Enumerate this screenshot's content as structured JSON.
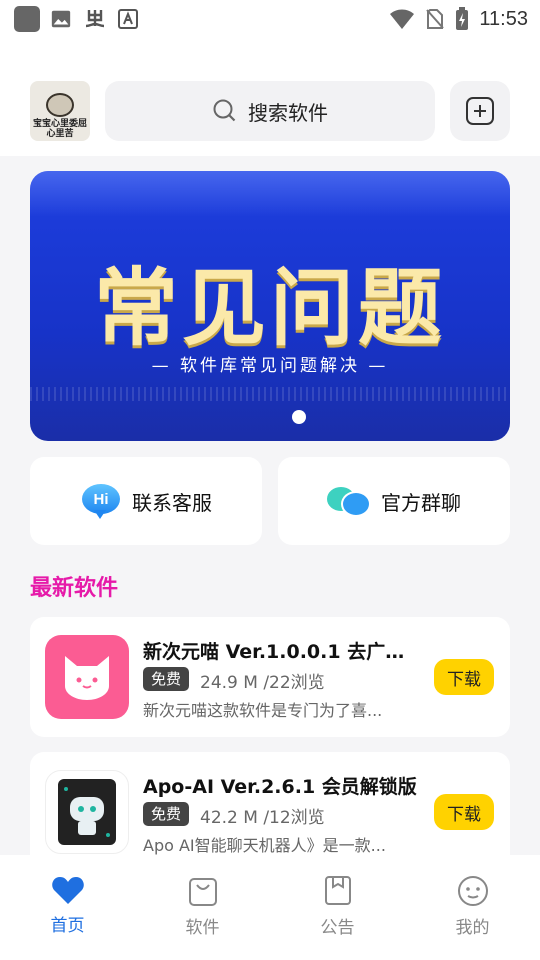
{
  "status_bar": {
    "time": "11:53"
  },
  "header": {
    "avatar_caption": "宝宝心里委屈心里苦",
    "search_placeholder": "搜索软件"
  },
  "banner": {
    "title": "常见问题",
    "subtitle": "— 软件库常见问题解决 —"
  },
  "quick_actions": [
    {
      "label": "联系客服",
      "icon": "hi-chat-icon"
    },
    {
      "label": "官方群聊",
      "icon": "group-chat-icon"
    }
  ],
  "section": {
    "title": "最新软件"
  },
  "apps": [
    {
      "name": "新次元喵 Ver.1.0.0.1 去广告...",
      "tag": "免费",
      "meta": "24.9 M /22浏览",
      "desc": "新次元喵这款软件是专门为了喜...",
      "button": "下载"
    },
    {
      "name": "Apo-AI Ver.2.6.1 会员解锁版",
      "tag": "免费",
      "meta": "42.2 M /12浏览",
      "desc": "Apo AI智能聊天机器人》是一款...",
      "button": "下载"
    }
  ],
  "nav": [
    {
      "label": "首页",
      "icon": "heart-icon",
      "active": true
    },
    {
      "label": "软件",
      "icon": "bag-icon",
      "active": false
    },
    {
      "label": "公告",
      "icon": "bookmark-icon",
      "active": false
    },
    {
      "label": "我的",
      "icon": "smiley-icon",
      "active": false
    }
  ],
  "colors": {
    "accent": "#1f6fe0",
    "section_title": "#e61aa9",
    "download_button": "#ffd200",
    "banner_blue": "#1e3fe0"
  }
}
